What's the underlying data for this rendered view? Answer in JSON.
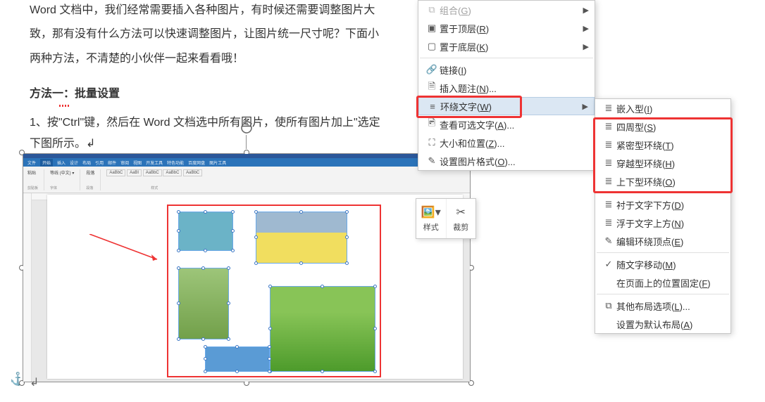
{
  "doc": {
    "para1": "Word 文档中，我们经常需要插入各种图片，有时候还需要调整图片大",
    "para2": "致，那有没有什么方法可以快速调整图片，让图片统一尺寸呢？下面小",
    "para3": "两种方法，不清楚的小伙伴一起来看看哦！",
    "heading": "方法一：批量设置",
    "body1": "1、按\"Ctrl\"键，然后在 Word 文档选中所有图片，使所有图片加上\"选定",
    "body2": "下图所示。↲"
  },
  "mini_toolbar": {
    "style_label": "样式",
    "crop_label": "裁剪"
  },
  "menu": {
    "items": [
      {
        "icon": "group-icon",
        "label": "组合(G)",
        "disabled": true,
        "sub": true
      },
      {
        "icon": "front-icon",
        "label": "置于顶层(R)",
        "disabled": false,
        "sub": true
      },
      {
        "icon": "back-icon",
        "label": "置于底层(K)",
        "disabled": false,
        "sub": true
      },
      {
        "icon": "link-icon",
        "label": "链接(I)",
        "disabled": false,
        "sub": false
      },
      {
        "icon": "caption-icon",
        "label": "插入题注(N)...",
        "disabled": false,
        "sub": false
      },
      {
        "icon": "wrap-icon",
        "label": "环绕文字(W)",
        "disabled": false,
        "sub": true,
        "highlight": true
      },
      {
        "icon": "alt-icon",
        "label": "查看可选文字(A)...",
        "disabled": false,
        "sub": false
      },
      {
        "icon": "size-icon",
        "label": "大小和位置(Z)...",
        "disabled": false,
        "sub": false
      },
      {
        "icon": "fmt-icon",
        "label": "设置图片格式(O)...",
        "disabled": false,
        "sub": false
      }
    ]
  },
  "submenu": {
    "group1": [
      {
        "icon": "inline-icon",
        "label": "嵌入型(I)"
      },
      {
        "icon": "square-icon",
        "label": "四周型(S)"
      },
      {
        "icon": "tight-icon",
        "label": "紧密型环绕(T)"
      },
      {
        "icon": "through-icon",
        "label": "穿越型环绕(H)"
      },
      {
        "icon": "topbot-icon",
        "label": "上下型环绕(O)"
      }
    ],
    "group2": [
      {
        "icon": "behind-icon",
        "label": "衬于文字下方(D)"
      },
      {
        "icon": "front2-icon",
        "label": "浮于文字上方(N)"
      },
      {
        "icon": "edit-icon",
        "label": "编辑环绕顶点(E)"
      }
    ],
    "group3": [
      {
        "checked": true,
        "label": "随文字移动(M)"
      },
      {
        "checked": false,
        "label": "在页面上的位置固定(F)"
      }
    ],
    "group4": [
      {
        "icon": "more-icon",
        "label": "其他布局选项(L)..."
      },
      {
        "icon": "",
        "label": "设置为默认布局(A)"
      }
    ]
  }
}
